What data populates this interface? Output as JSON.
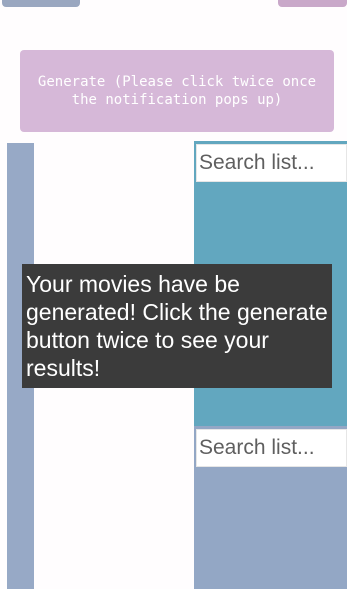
{
  "generate_button": {
    "label": "Generate (Please click twice once the notification pops up)"
  },
  "lists": [
    {
      "search_placeholder": "Search list..."
    },
    {
      "search_placeholder": "Search list..."
    }
  ],
  "notification": {
    "text": "Your movies have be generated! Click the generate button twice to see your results!"
  },
  "colors": {
    "generate_button_bg": "#d6b8d8",
    "top_list_bg": "#62a7bf",
    "bottom_list_bg": "#93a7c5",
    "left_panel_bg": "#97a9c6",
    "notification_bg": "#3b3b3b"
  }
}
